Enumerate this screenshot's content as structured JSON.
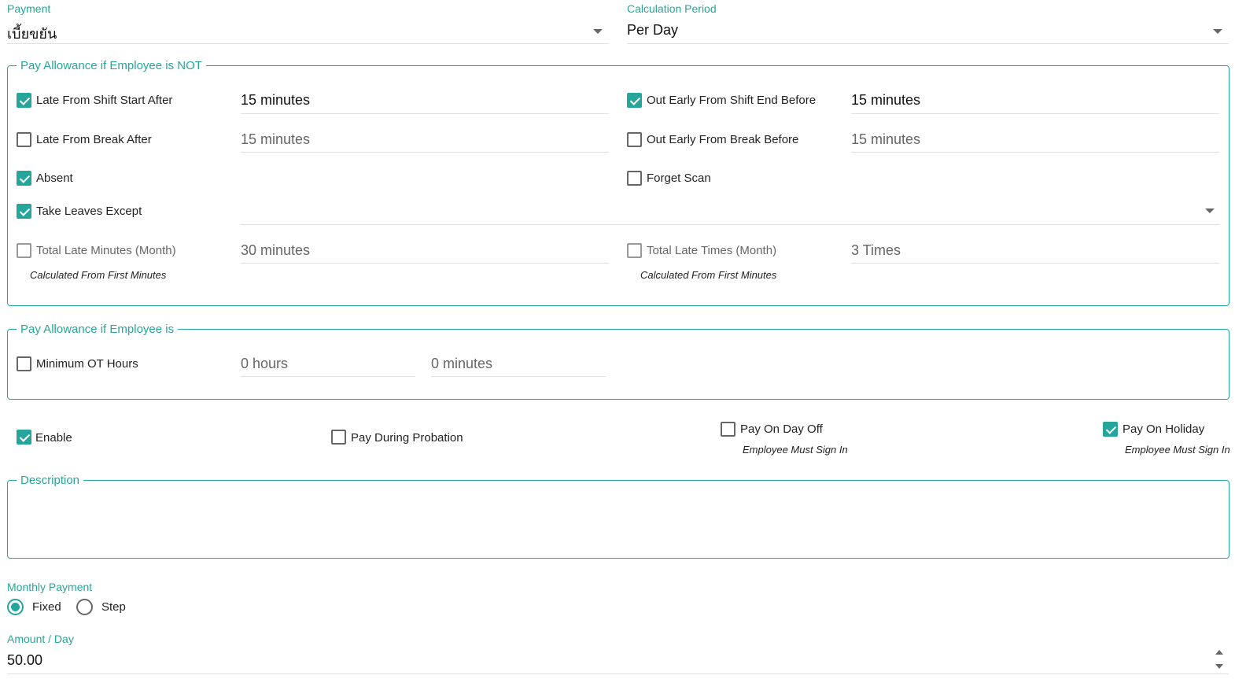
{
  "payment": {
    "label": "Payment",
    "value": "เบี้ยขยัน"
  },
  "calc_period": {
    "label": "Calculation Period",
    "value": "Per Day"
  },
  "not_section": {
    "legend": "Pay Allowance if Employee is NOT",
    "late_shift": {
      "label": "Late From Shift Start After",
      "checked": true,
      "value": "15 minutes"
    },
    "out_early_shift": {
      "label": "Out Early From Shift End Before",
      "checked": true,
      "value": "15 minutes"
    },
    "late_break": {
      "label": "Late From Break After",
      "checked": false,
      "value": "15 minutes"
    },
    "out_early_break": {
      "label": "Out Early From Break Before",
      "checked": false,
      "value": "15 minutes"
    },
    "absent": {
      "label": "Absent",
      "checked": true
    },
    "forget_scan": {
      "label": "Forget Scan",
      "checked": false
    },
    "take_leaves": {
      "label": "Take Leaves Except",
      "checked": true,
      "value": ""
    },
    "total_late_minutes": {
      "label": "Total Late Minutes (Month)",
      "checked": false,
      "value": "30 minutes",
      "note": "Calculated From First Minutes"
    },
    "total_late_times": {
      "label": "Total Late Times (Month)",
      "checked": false,
      "value": "3 Times",
      "note": "Calculated From First Minutes"
    }
  },
  "is_section": {
    "legend": "Pay Allowance if Employee is",
    "min_ot": {
      "label": "Minimum OT Hours",
      "checked": false,
      "hours": "0 hours",
      "minutes": "0 minutes"
    }
  },
  "flags": {
    "enable": {
      "label": "Enable",
      "checked": true
    },
    "probation": {
      "label": "Pay During Probation",
      "checked": false
    },
    "day_off": {
      "label": "Pay On Day Off",
      "checked": false,
      "note": "Employee Must Sign In"
    },
    "holiday": {
      "label": "Pay On Holiday",
      "checked": true,
      "note": "Employee Must Sign In"
    }
  },
  "description": {
    "legend": "Description",
    "value": ""
  },
  "monthly_payment": {
    "label": "Monthly Payment",
    "options": [
      {
        "label": "Fixed",
        "selected": true
      },
      {
        "label": "Step",
        "selected": false
      }
    ]
  },
  "amount": {
    "label": "Amount / Day",
    "value": "50.00"
  },
  "colors": {
    "accent": "#26a69a"
  }
}
